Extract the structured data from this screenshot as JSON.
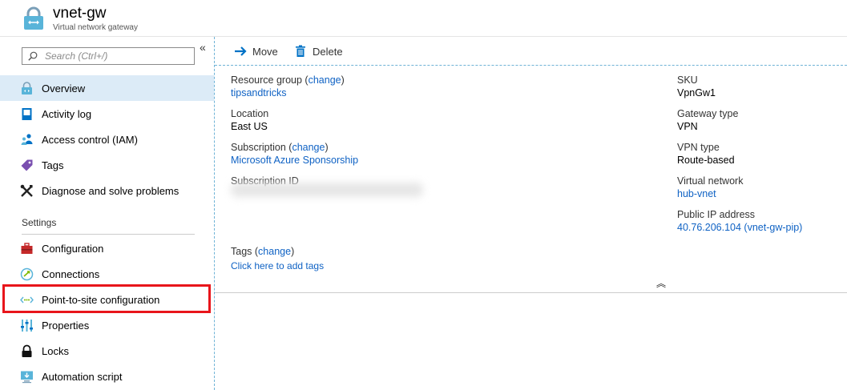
{
  "header": {
    "title": "vnet-gw",
    "subtitle": "Virtual network gateway",
    "icon": "lock-gateway-icon"
  },
  "sidebar": {
    "collapse_glyph": "«",
    "search_placeholder": "Search (Ctrl+/)",
    "items": [
      {
        "label": "Overview",
        "icon": "overview-icon",
        "selected": true
      },
      {
        "label": "Activity log",
        "icon": "activity-log-icon"
      },
      {
        "label": "Access control (IAM)",
        "icon": "iam-icon"
      },
      {
        "label": "Tags",
        "icon": "tag-icon"
      },
      {
        "label": "Diagnose and solve problems",
        "icon": "wrench-icon"
      }
    ],
    "settings_header": "Settings",
    "settings_items": [
      {
        "label": "Configuration",
        "icon": "toolbox-icon"
      },
      {
        "label": "Connections",
        "icon": "connections-icon"
      },
      {
        "label": "Point-to-site configuration",
        "icon": "point-to-site-icon",
        "highlighted": true
      },
      {
        "label": "Properties",
        "icon": "properties-icon"
      },
      {
        "label": "Locks",
        "icon": "lock-icon"
      },
      {
        "label": "Automation script",
        "icon": "automation-icon"
      }
    ]
  },
  "toolbar": {
    "move_label": "Move",
    "delete_label": "Delete"
  },
  "essentials": {
    "resource_group_label": "Resource group",
    "change_link": "change",
    "resource_group_value": "tipsandtricks",
    "location_label": "Location",
    "location_value": "East US",
    "subscription_label": "Subscription",
    "subscription_value": "Microsoft Azure Sponsorship",
    "subscription_id_label": "Subscription ID",
    "sku_label": "SKU",
    "sku_value": "VpnGw1",
    "gateway_type_label": "Gateway type",
    "gateway_type_value": "VPN",
    "vpn_type_label": "VPN type",
    "vpn_type_value": "Route-based",
    "virtual_network_label": "Virtual network",
    "virtual_network_value": "hub-vnet",
    "public_ip_label": "Public IP address",
    "public_ip_value": "40.76.206.104 (vnet-gw-pip)",
    "tags_label": "Tags",
    "tags_add_link": "Click here to add tags",
    "expand_glyph": "︽"
  },
  "colors": {
    "link": "#0f62c4",
    "selected_bg": "#dcebf7",
    "highlight_border": "#e8151b"
  }
}
